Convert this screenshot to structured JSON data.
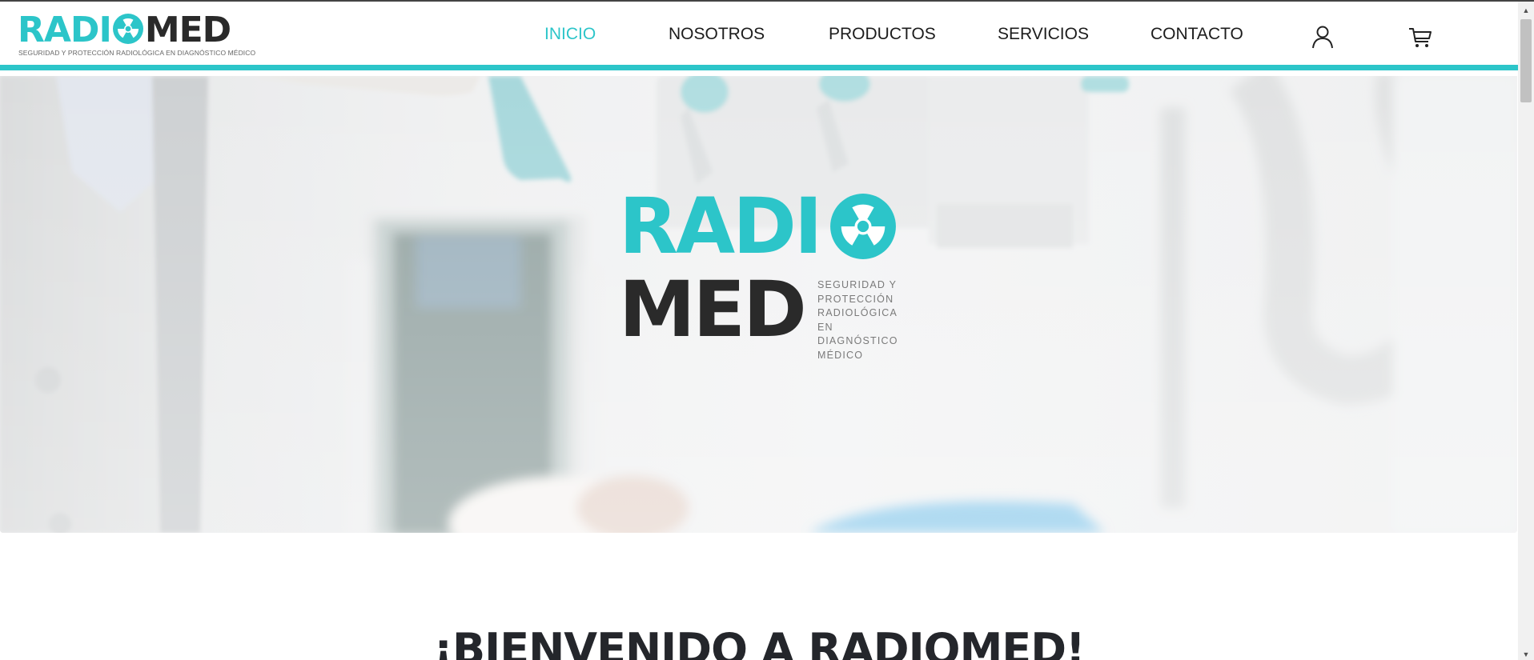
{
  "brand": {
    "logo_left": "RADI",
    "logo_right": "MED",
    "tagline": "SEGURIDAD Y PROTECCIÓN RADIOLÓGICA EN DIAGNÓSTICO MÉDICO",
    "accent_color": "#2cc5c9",
    "dark_color": "#2a2a2a"
  },
  "nav": {
    "items": [
      {
        "label": "INICIO",
        "active": true
      },
      {
        "label": "NOSOTROS",
        "active": false
      },
      {
        "label": "PRODUCTOS",
        "active": false
      },
      {
        "label": "SERVICIOS",
        "active": false
      },
      {
        "label": "CONTACTO",
        "active": false
      }
    ],
    "account_icon": "user-icon",
    "cart_icon": "shopping-cart-icon"
  },
  "hero": {
    "logo_top": "RADI",
    "logo_bottom": "MED",
    "tagline_lines": [
      "SEGURIDAD Y",
      "PROTECCIÓN",
      "RADIOLÓGICA EN",
      "DIAGNÓSTICO",
      "MÉDICO"
    ]
  },
  "welcome": {
    "heading": "¡BIENVENIDO A RADIOMED!"
  }
}
